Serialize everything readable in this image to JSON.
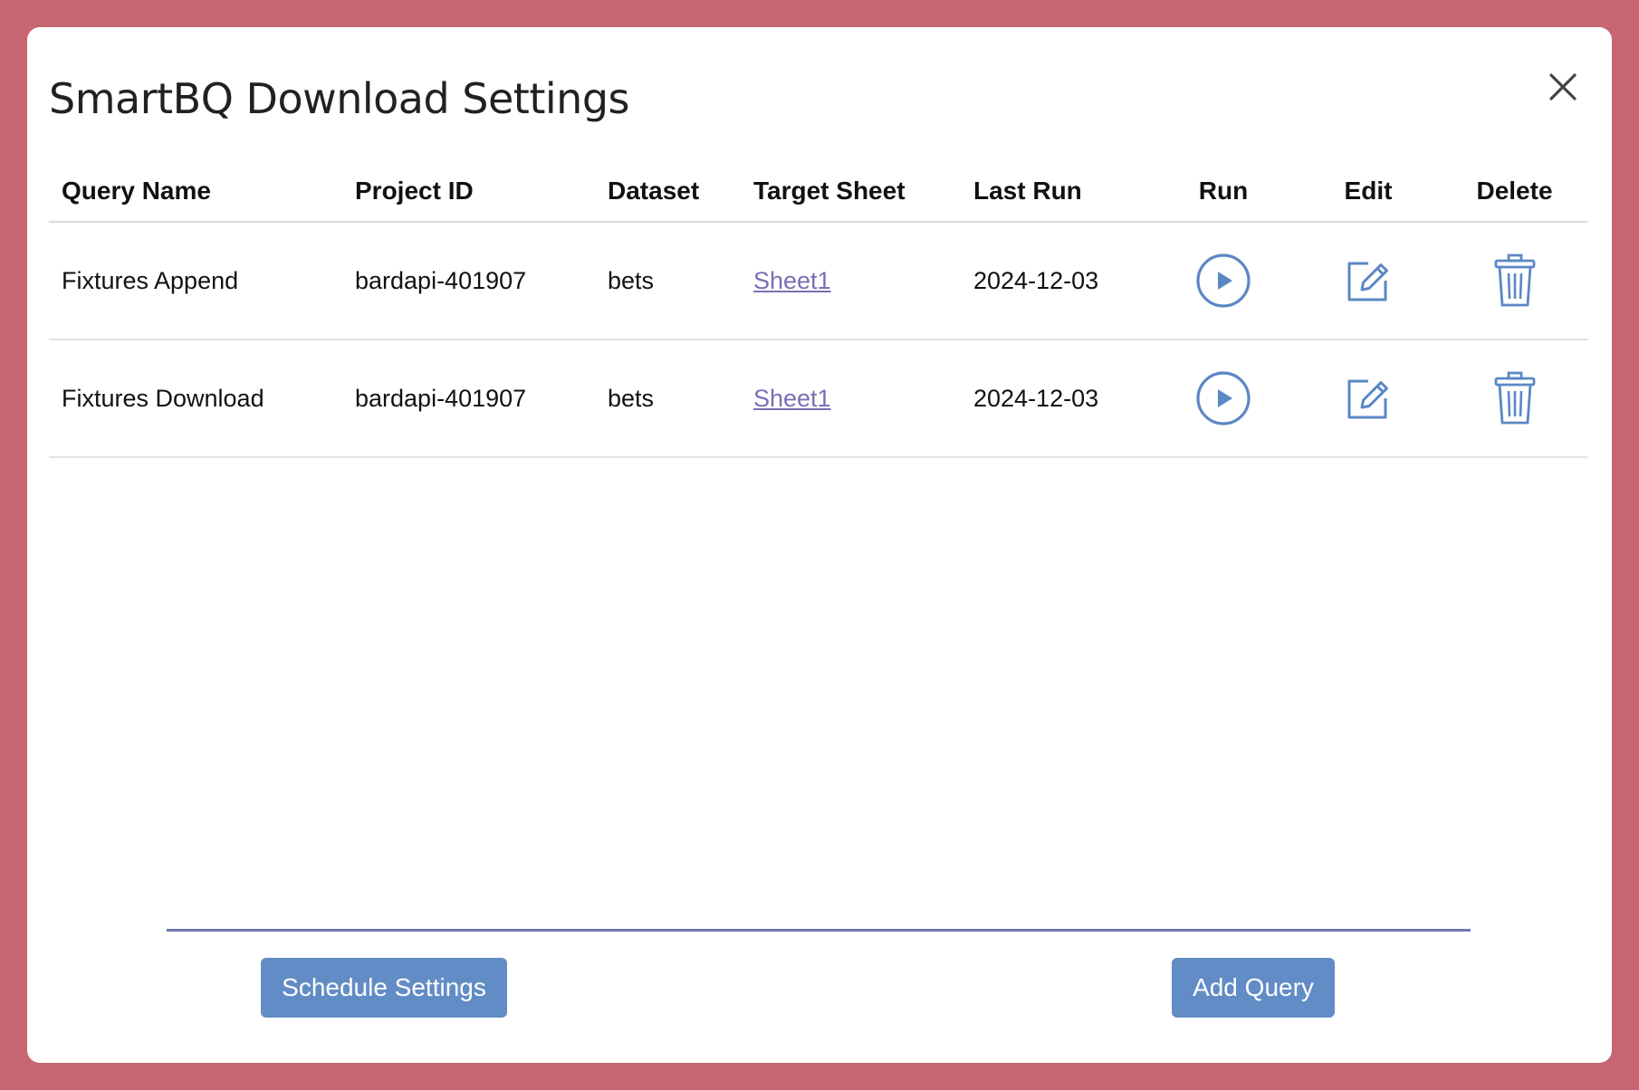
{
  "dialog": {
    "title": "SmartBQ Download Settings",
    "close_icon": "close-icon"
  },
  "table": {
    "headers": {
      "query_name": "Query Name",
      "project_id": "Project ID",
      "dataset": "Dataset",
      "target_sheet": "Target Sheet",
      "last_run": "Last Run",
      "run": "Run",
      "edit": "Edit",
      "delete": "Delete"
    },
    "rows": [
      {
        "query_name": "Fixtures Append",
        "project_id": "bardapi-401907",
        "dataset": "bets",
        "target_sheet": "Sheet1",
        "last_run": "2024-12-03",
        "run_icon": "play-circle-icon",
        "edit_icon": "edit-icon",
        "delete_icon": "trash-icon"
      },
      {
        "query_name": "Fixtures Download",
        "project_id": "bardapi-401907",
        "dataset": "bets",
        "target_sheet": "Sheet1",
        "last_run": "2024-12-03",
        "run_icon": "play-circle-icon",
        "edit_icon": "edit-icon",
        "delete_icon": "trash-icon"
      }
    ]
  },
  "footer": {
    "schedule_label": "Schedule Settings",
    "add_label": "Add Query"
  },
  "colors": {
    "frame": "#c86573",
    "accent": "#628cc5",
    "icon": "#5b87c4",
    "link": "#7a6fb4",
    "divider": "#7177b4"
  }
}
